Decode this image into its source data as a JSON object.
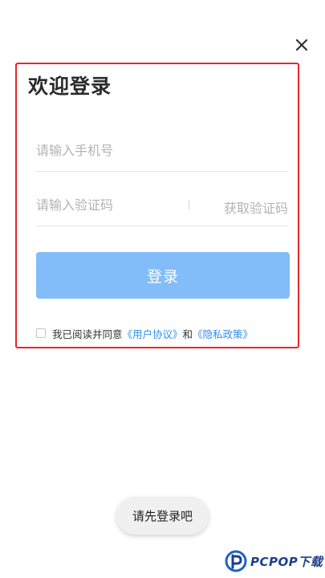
{
  "header": {
    "close_icon": "close-icon"
  },
  "login": {
    "title": "欢迎登录",
    "phone_placeholder": "请输入手机号",
    "code_placeholder": "请输入验证码",
    "get_code_label": "获取验证码",
    "login_button_label": "登录",
    "agreement": {
      "prefix": "我已阅读并同意",
      "user_agreement": "《用户协议》",
      "and": "和",
      "privacy_policy": "《隐私政策》",
      "checked": false
    }
  },
  "toast": {
    "message": "请先登录吧"
  },
  "watermark": {
    "text": "PCPOP下载"
  },
  "colors": {
    "accent": "#82bdf9",
    "link": "#2f8ff0",
    "highlight_border": "#e8262a"
  }
}
